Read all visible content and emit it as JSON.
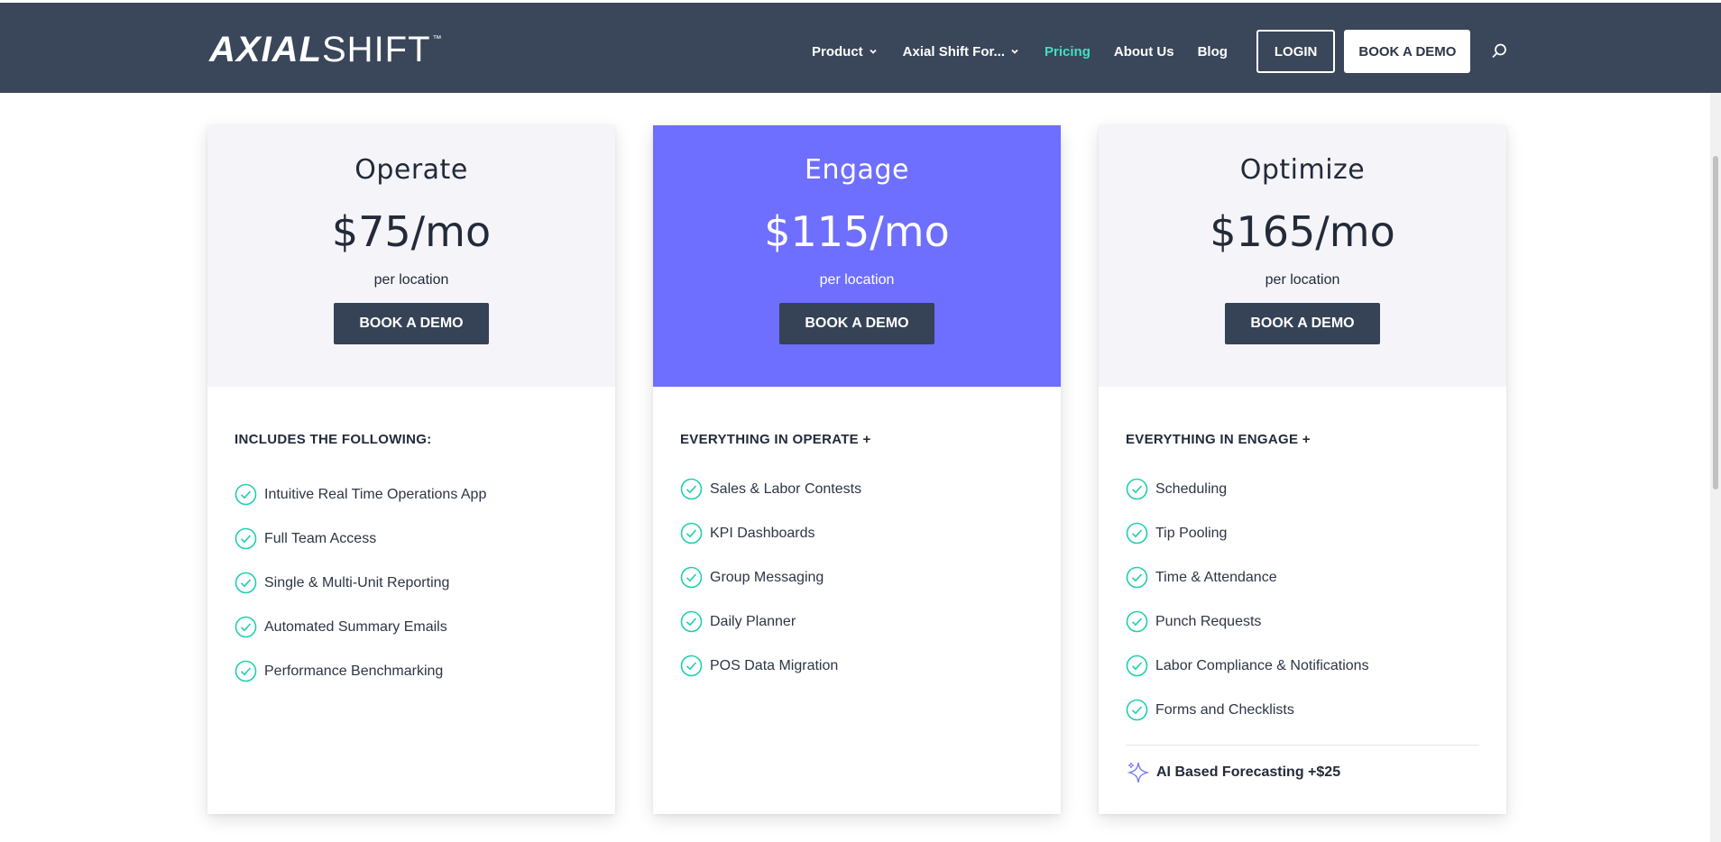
{
  "header": {
    "logo": {
      "bold": "AXIAL",
      "light": "SHIFT",
      "tm": "™"
    },
    "nav": {
      "product": "Product",
      "axial_for": "Axial Shift For...",
      "pricing": "Pricing",
      "about": "About Us",
      "blog": "Blog"
    },
    "login_label": "LOGIN",
    "demo_label": "BOOK A DEMO",
    "colors": {
      "background": "#3a4659",
      "active_link": "#3fe0c5"
    }
  },
  "plans": [
    {
      "name": "Operate",
      "price": "$75/mo",
      "unit": "per location",
      "button": "BOOK A DEMO",
      "features_title": "INCLUDES THE FOLLOWING:",
      "features": [
        "Intuitive Real Time Operations App",
        "Full Team Access",
        "Single & Multi-Unit Reporting",
        "Automated Summary Emails",
        "Performance Benchmarking"
      ]
    },
    {
      "name": "Engage",
      "price": "$115/mo",
      "unit": "per location",
      "button": "BOOK A DEMO",
      "features_title": "EVERYTHING IN OPERATE +",
      "features": [
        "Sales & Labor Contests",
        "KPI Dashboards",
        "Group Messaging",
        "Daily Planner",
        "POS Data Migration"
      ]
    },
    {
      "name": "Optimize",
      "price": "$165/mo",
      "unit": "per location",
      "button": "BOOK A DEMO",
      "features_title": "EVERYTHING IN ENGAGE +",
      "features": [
        "Scheduling",
        "Tip Pooling",
        "Time & Attendance",
        "Punch Requests",
        "Labor Compliance & Notifications",
        "Forms and Checklists"
      ],
      "addon": "AI Based Forecasting +$25"
    }
  ],
  "colors": {
    "featured": "#6e6ffe",
    "check": "#1fcfb0",
    "button": "#364256",
    "card_head": "#f5f5f9"
  }
}
